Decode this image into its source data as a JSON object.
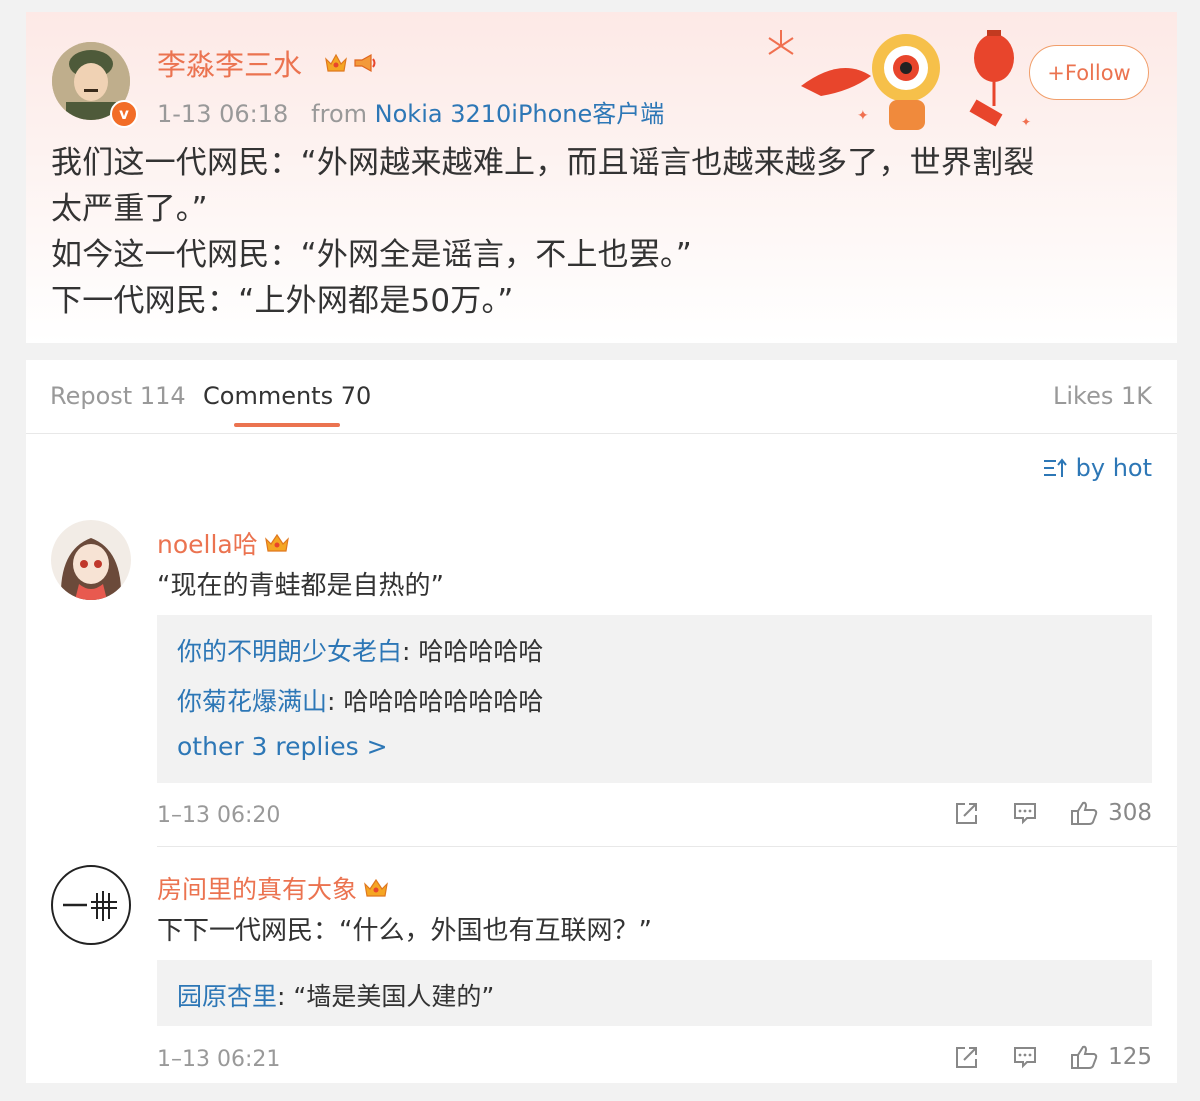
{
  "post": {
    "author": "李淼李三水",
    "time": "1-13 06:18",
    "from_label": "from",
    "source": "Nokia 3210iPhone客户端",
    "follow_label": "+Follow",
    "text_lines": [
      "我们这一代网民：“外网越来越难上，而且谣言也越来越多了，世界割裂",
      "太严重了。”",
      "如今这一代网民：“外网全是谣言，不上也罢。”",
      "下一代网民：“上外网都是50万。”"
    ],
    "verified_badge": "v"
  },
  "tabs": {
    "repost": "Repost 114",
    "comments": "Comments 70",
    "likes": "Likes 1K"
  },
  "sort": {
    "label": "by hot"
  },
  "comments": [
    {
      "name": "noella哈",
      "text": "“现在的青蛙都是自热的”",
      "replies": [
        {
          "name": "你的不明朗少女老白",
          "text": ": 哈哈哈哈哈"
        },
        {
          "name": "你菊花爆满山",
          "text": ": 哈哈哈哈哈哈哈哈"
        }
      ],
      "more_replies": "other 3 replies >",
      "time": "1–13 06:20",
      "likes": "308"
    },
    {
      "name": "房间里的真有大象",
      "text": "下下一代网民：“什么，外国也有互联网？”",
      "replies": [
        {
          "name": "园原杏里",
          "text": ": “墙是美国人建的”"
        }
      ],
      "time": "1–13 06:21",
      "likes": "125"
    }
  ],
  "colors": {
    "accent": "#eb7350",
    "link": "#2d77b6",
    "text": "#333333",
    "muted": "#999999",
    "reply_bg": "#f2f2f2"
  }
}
